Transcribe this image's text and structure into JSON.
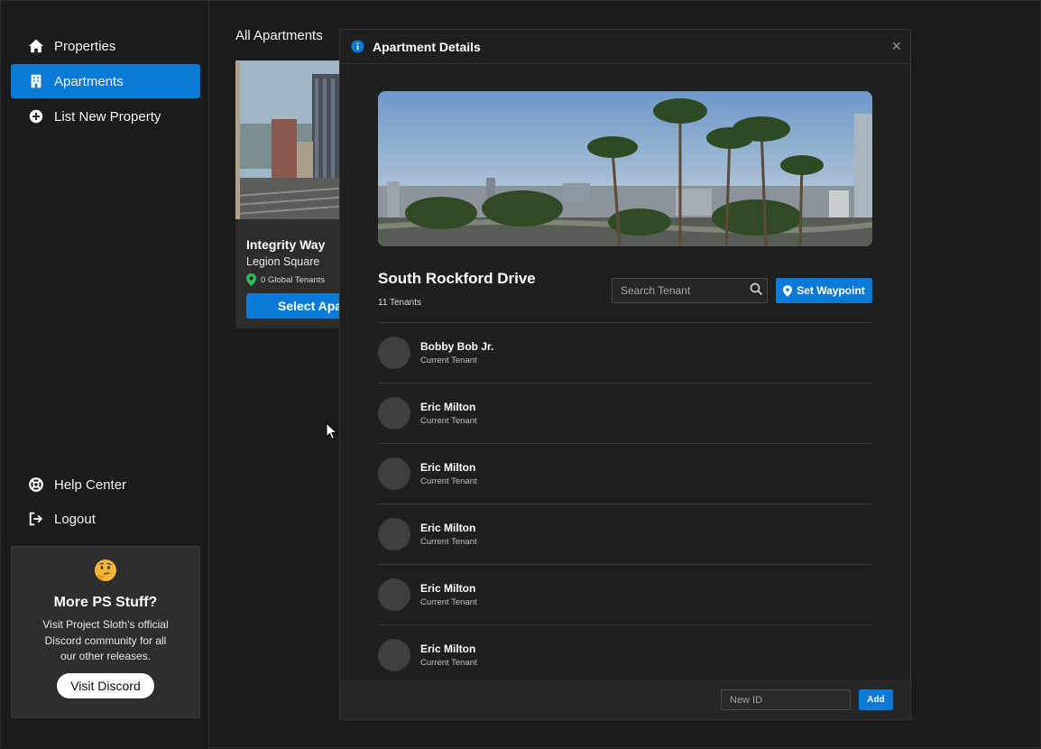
{
  "sidebar": {
    "items": [
      {
        "label": "Properties",
        "icon": "home-icon"
      },
      {
        "label": "Apartments",
        "icon": "building-icon",
        "active": true
      },
      {
        "label": "List New Property",
        "icon": "plus-circle-icon"
      }
    ],
    "bottom_items": [
      {
        "label": "Help Center",
        "icon": "lifebuoy-icon"
      },
      {
        "label": "Logout",
        "icon": "logout-icon"
      }
    ],
    "promo": {
      "title": "More PS Stuff?",
      "text": "Visit Project Sloth's official Discord community for all our other releases.",
      "button": "Visit Discord",
      "icon": "thinking-face-icon"
    }
  },
  "main": {
    "title": "All Apartments",
    "card": {
      "name": "Integrity Way",
      "area": "Legion Square",
      "tenants": "0 Global Tenants",
      "button": "Select Apartment"
    }
  },
  "modal": {
    "title": "Apartment Details",
    "close": "×",
    "apartment_name": "South Rockford Drive",
    "tenant_count": "11 Tenants",
    "search_placeholder": "Search Tenant",
    "waypoint_button": "Set Waypoint",
    "tenants": [
      {
        "name": "Bobby Bob Jr.",
        "role": "Current Tenant"
      },
      {
        "name": "Eric Milton",
        "role": "Current Tenant"
      },
      {
        "name": "Eric Milton",
        "role": "Current Tenant"
      },
      {
        "name": "Eric Milton",
        "role": "Current Tenant"
      },
      {
        "name": "Eric Milton",
        "role": "Current Tenant"
      },
      {
        "name": "Eric Milton",
        "role": "Current Tenant"
      }
    ],
    "footer": {
      "new_id_placeholder": "New ID",
      "add_button": "Add"
    }
  },
  "colors": {
    "accent": "#0b79d6",
    "background": "#1b1b1b",
    "panel": "#1f1f1f",
    "pin_green": "#2bbf5a"
  }
}
